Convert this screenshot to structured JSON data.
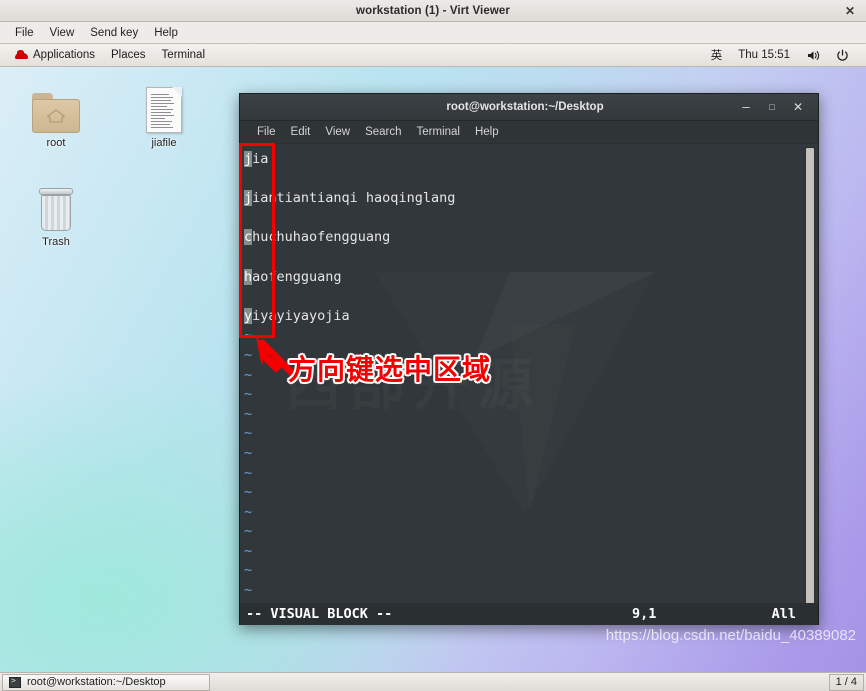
{
  "viewer": {
    "title": "workstation (1) - Virt Viewer",
    "close_label": "✕",
    "menu": [
      "File",
      "View",
      "Send key",
      "Help"
    ]
  },
  "gnome_panel": {
    "applications": "Applications",
    "places": "Places",
    "terminal": "Terminal",
    "input_method": "英",
    "clock": "Thu 15:51",
    "volume_icon": "volume-icon",
    "power_icon": "power-icon"
  },
  "desktop": {
    "icons": [
      {
        "label": "root",
        "type": "home-folder"
      },
      {
        "label": "jiafile",
        "type": "text-document"
      },
      {
        "label": "Trash",
        "type": "trash-can"
      }
    ],
    "watermark_url": "https://blog.csdn.net/baidu_40389082"
  },
  "terminal": {
    "title": "root@workstation:~/Desktop",
    "minimize_label": "–",
    "maximize_label": "□",
    "close_label": "✕",
    "menu": [
      "File",
      "Edit",
      "View",
      "Search",
      "Terminal",
      "Help"
    ],
    "background_watermark": "西部开源"
  },
  "vim": {
    "lines": [
      {
        "selected": "j",
        "rest": "ia"
      },
      {
        "selected": "",
        "rest": ""
      },
      {
        "selected": "j",
        "rest": "iantiantianqi haoqinglang"
      },
      {
        "selected": "",
        "rest": ""
      },
      {
        "selected": "c",
        "rest": "huchuhaofengguang"
      },
      {
        "selected": "",
        "rest": ""
      },
      {
        "selected": "h",
        "rest": "aofengguang"
      },
      {
        "selected": "",
        "rest": ""
      },
      {
        "selected": "y",
        "rest": "iyayiyayojia"
      }
    ],
    "tilde_count": 15,
    "tilde": "~",
    "status": {
      "mode": "-- VISUAL BLOCK --",
      "position": "9,1",
      "percent": "All"
    }
  },
  "annotation": {
    "text": "方向键选中区域",
    "color": "#f40000"
  },
  "taskbar": {
    "window_button": "root@workstation:~/Desktop",
    "workspace": "1 / 4"
  }
}
